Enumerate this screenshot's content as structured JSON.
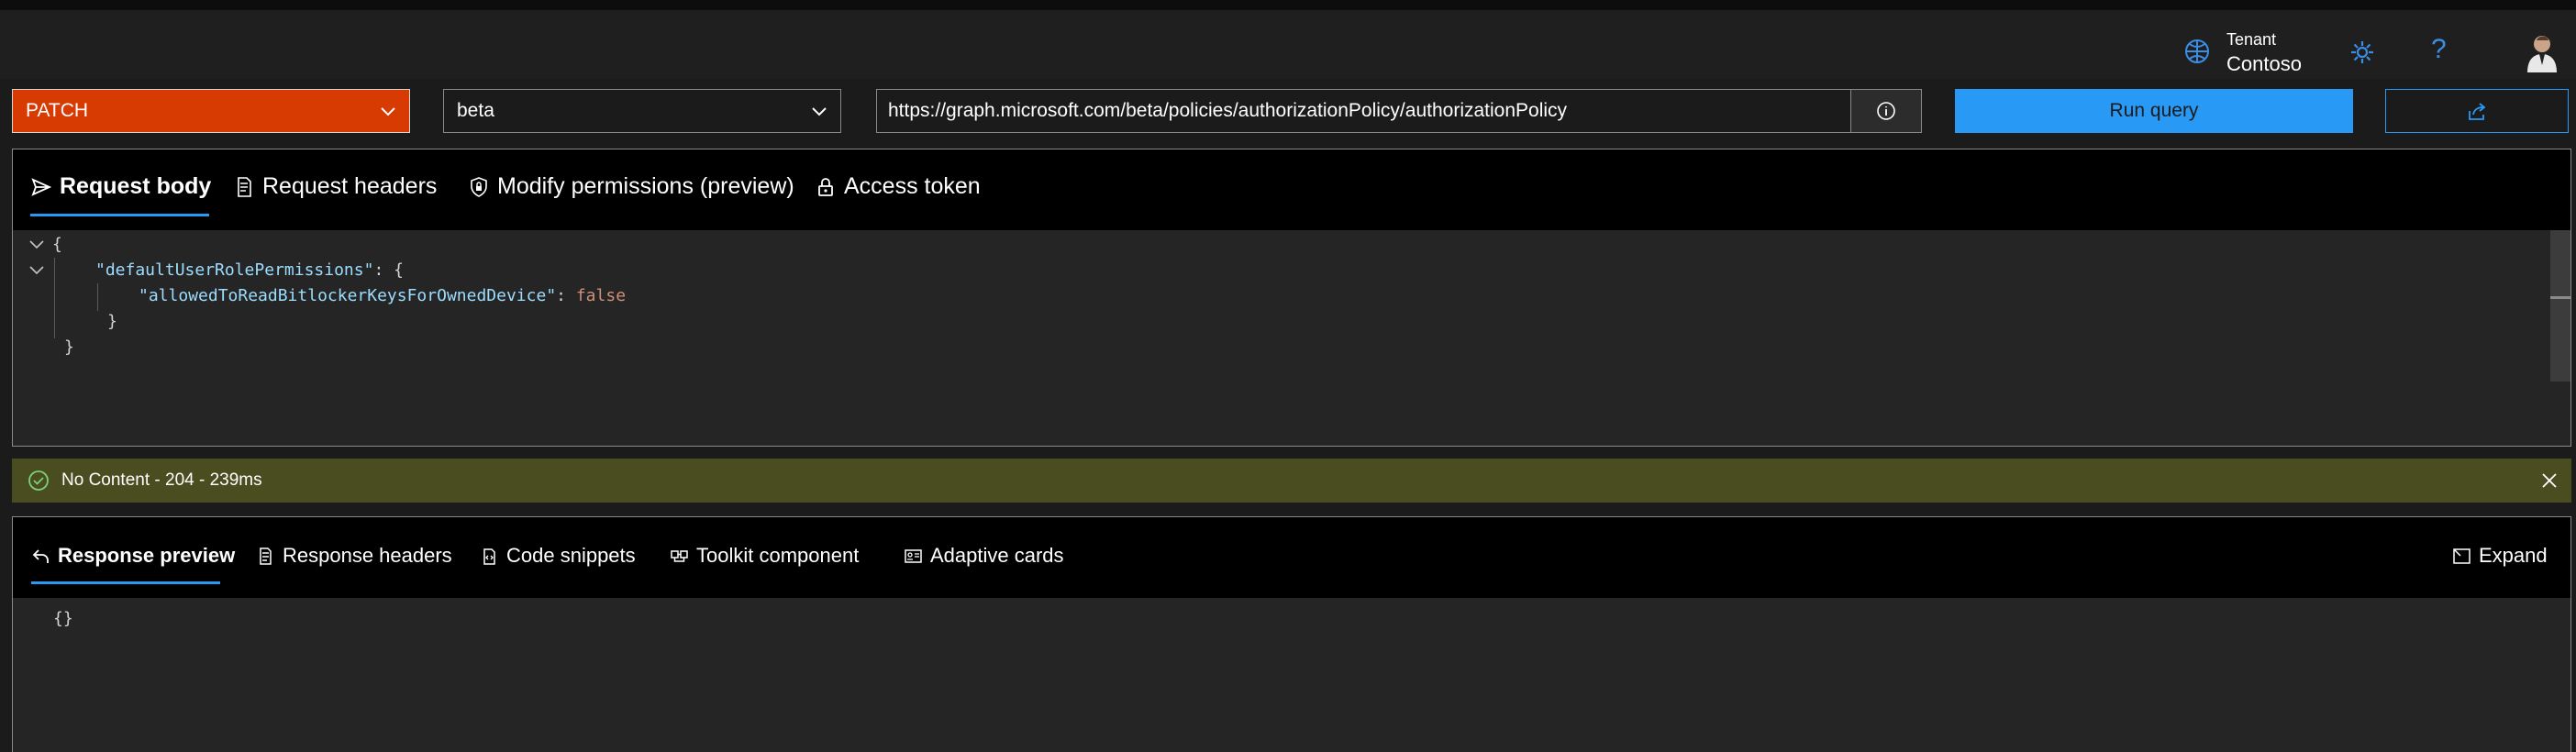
{
  "header": {
    "tenant_label": "Tenant",
    "tenant_name": "Contoso",
    "help_glyph": "?"
  },
  "query": {
    "method": "PATCH",
    "version": "beta",
    "url": "https://graph.microsoft.com/beta/policies/authorizationPolicy/authorizationPolicy",
    "run_label": "Run query"
  },
  "request_tabs": [
    {
      "label": "Request body",
      "icon": "send-icon",
      "active": true
    },
    {
      "label": "Request headers",
      "icon": "document-icon",
      "active": false
    },
    {
      "label": "Modify permissions (preview)",
      "icon": "shield-lock-icon",
      "active": false
    },
    {
      "label": "Access token",
      "icon": "lock-icon",
      "active": false
    }
  ],
  "request_body": {
    "line1": "{",
    "key1": "\"defaultUserRolePermissions\"",
    "line2_tail": ": {",
    "key2": "\"allowedToReadBitlockerKeysForOwnedDevice\"",
    "line3_sep": ": ",
    "value2": "false",
    "line4": "}",
    "line5": "}"
  },
  "status": {
    "text": "No Content - 204 - 239ms"
  },
  "response_tabs": [
    {
      "label": "Response preview",
      "icon": "back-arrow-icon",
      "active": true
    },
    {
      "label": "Response headers",
      "icon": "document-icon",
      "active": false
    },
    {
      "label": "Code snippets",
      "icon": "code-icon",
      "active": false
    },
    {
      "label": "Toolkit component",
      "icon": "toolkit-icon",
      "active": false
    },
    {
      "label": "Adaptive cards",
      "icon": "card-icon",
      "active": false
    }
  ],
  "expand_label": "Expand",
  "response_body": "{}",
  "colors": {
    "accent": "#2899f5",
    "method_patch": "#d83b01",
    "status_bar": "#4a4d20",
    "json_key": "#9cdcfe",
    "json_bool": "#ce9178"
  }
}
